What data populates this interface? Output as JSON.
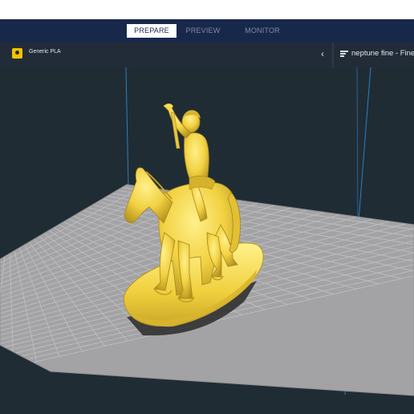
{
  "header": {
    "tabs": [
      {
        "label": "PREPARE",
        "active": true
      },
      {
        "label": "PREVIEW",
        "active": false
      },
      {
        "label": "MONITOR",
        "active": false
      }
    ]
  },
  "material": {
    "label": "Generic PLA",
    "icon": "spool-icon",
    "color": "#f3c200"
  },
  "profile": {
    "label": "neptune fine - Fine -",
    "icon": "sliders-icon"
  },
  "colors": {
    "header_bg": "#18284a",
    "toolbar_bg": "#222c38",
    "viewport_bg": "#202c34",
    "build_plate": "#a3a3a5",
    "grid_line": "#c2c2c4",
    "model": "#f2d243"
  }
}
